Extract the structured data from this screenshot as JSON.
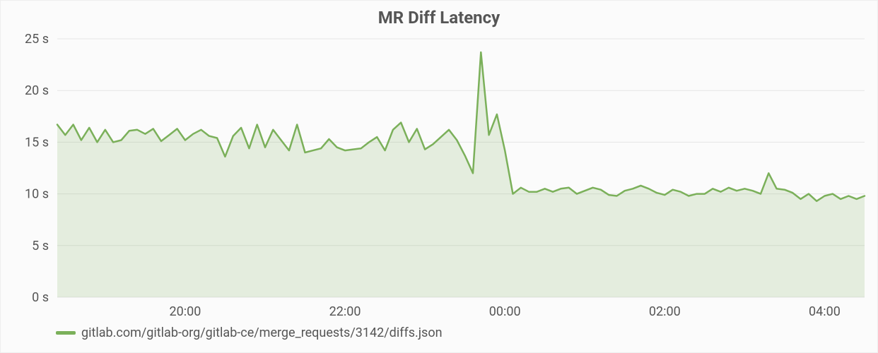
{
  "chart_data": {
    "type": "area",
    "title": "MR Diff Latency",
    "xlabel": "",
    "ylabel": "",
    "ylim": [
      0,
      25
    ],
    "y_ticks": [
      0,
      5,
      10,
      15,
      20,
      25
    ],
    "y_tick_suffix": " s",
    "x_ticks": [
      "20:00",
      "22:00",
      "00:00",
      "02:00",
      "04:00"
    ],
    "x_range_minutes": [
      1104,
      1710
    ],
    "x_tick_minutes": [
      1200,
      1320,
      1440,
      1560,
      1680
    ],
    "series": [
      {
        "name": "gitlab.com/gitlab-org/gitlab-ce/merge_requests/3142/diffs.json",
        "color": "#7bb05a",
        "x": [
          1104,
          1110,
          1116,
          1122,
          1128,
          1134,
          1140,
          1146,
          1152,
          1158,
          1164,
          1170,
          1176,
          1182,
          1188,
          1194,
          1200,
          1206,
          1212,
          1218,
          1224,
          1230,
          1236,
          1242,
          1248,
          1254,
          1260,
          1266,
          1272,
          1278,
          1284,
          1290,
          1296,
          1302,
          1308,
          1314,
          1320,
          1326,
          1332,
          1338,
          1344,
          1350,
          1356,
          1362,
          1368,
          1374,
          1380,
          1386,
          1392,
          1398,
          1404,
          1410,
          1416,
          1422,
          1428,
          1434,
          1440,
          1446,
          1452,
          1458,
          1464,
          1470,
          1476,
          1482,
          1488,
          1494,
          1500,
          1506,
          1512,
          1518,
          1524,
          1530,
          1536,
          1542,
          1548,
          1554,
          1560,
          1566,
          1572,
          1578,
          1584,
          1590,
          1596,
          1602,
          1608,
          1614,
          1620,
          1626,
          1632,
          1638,
          1644,
          1650,
          1656,
          1662,
          1668,
          1674,
          1680,
          1686,
          1692,
          1698,
          1704,
          1710
        ],
        "values": [
          16.7,
          15.7,
          16.7,
          15.2,
          16.4,
          15.0,
          16.2,
          15.0,
          15.2,
          16.1,
          16.2,
          15.8,
          16.3,
          15.1,
          15.7,
          16.3,
          15.2,
          15.8,
          16.2,
          15.6,
          15.4,
          13.6,
          15.6,
          16.4,
          14.4,
          16.7,
          14.5,
          16.2,
          15.2,
          14.2,
          16.7,
          14.0,
          14.2,
          14.4,
          15.3,
          14.5,
          14.2,
          14.3,
          14.4,
          15.0,
          15.5,
          14.2,
          16.2,
          16.9,
          15.0,
          16.3,
          14.3,
          14.8,
          15.5,
          16.2,
          15.2,
          13.7,
          12.0,
          23.7,
          15.7,
          17.7,
          14.2,
          10.0,
          10.6,
          10.2,
          10.2,
          10.5,
          10.2,
          10.5,
          10.6,
          10.0,
          10.3,
          10.6,
          10.4,
          9.9,
          9.8,
          10.3,
          10.5,
          10.8,
          10.5,
          10.1,
          9.9,
          10.4,
          10.2,
          9.8,
          10.0,
          10.0,
          10.5,
          10.2,
          10.6,
          10.3,
          10.5,
          10.3,
          10.0,
          12.0,
          10.5,
          10.4,
          10.1,
          9.5,
          10.0,
          9.3,
          9.8,
          10.0,
          9.5,
          9.8,
          9.5,
          9.8
        ]
      }
    ]
  },
  "legend": {
    "items": [
      {
        "label": "gitlab.com/gitlab-org/gitlab-ce/merge_requests/3142/diffs.json"
      }
    ]
  }
}
